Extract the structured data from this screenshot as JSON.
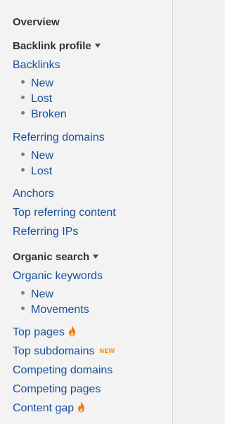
{
  "nav": {
    "overview": "Overview",
    "backlink_profile": {
      "title": "Backlink profile",
      "backlinks": "Backlinks",
      "backlinks_sub": [
        "New",
        "Lost",
        "Broken"
      ],
      "referring_domains": "Referring domains",
      "referring_domains_sub": [
        "New",
        "Lost"
      ],
      "anchors": "Anchors",
      "top_referring_content": "Top referring content",
      "referring_ips": "Referring IPs"
    },
    "organic_search": {
      "title": "Organic search",
      "organic_keywords": "Organic keywords",
      "organic_keywords_sub": [
        "New",
        "Movements"
      ],
      "top_pages": "Top pages",
      "top_subdomains": "Top subdomains",
      "top_subdomains_badge": "NEW",
      "competing_domains": "Competing domains",
      "competing_pages": "Competing pages",
      "content_gap": "Content gap"
    }
  },
  "icons": {
    "section_toggle": "caret-down-icon",
    "hot": "flame-icon"
  },
  "colors": {
    "link": "#1a4f9a",
    "heading": "#333333",
    "badge": "#f28c00",
    "flame": "#f07c1b",
    "bullet": "#6a7fa3",
    "background": "#f3f3f3"
  }
}
